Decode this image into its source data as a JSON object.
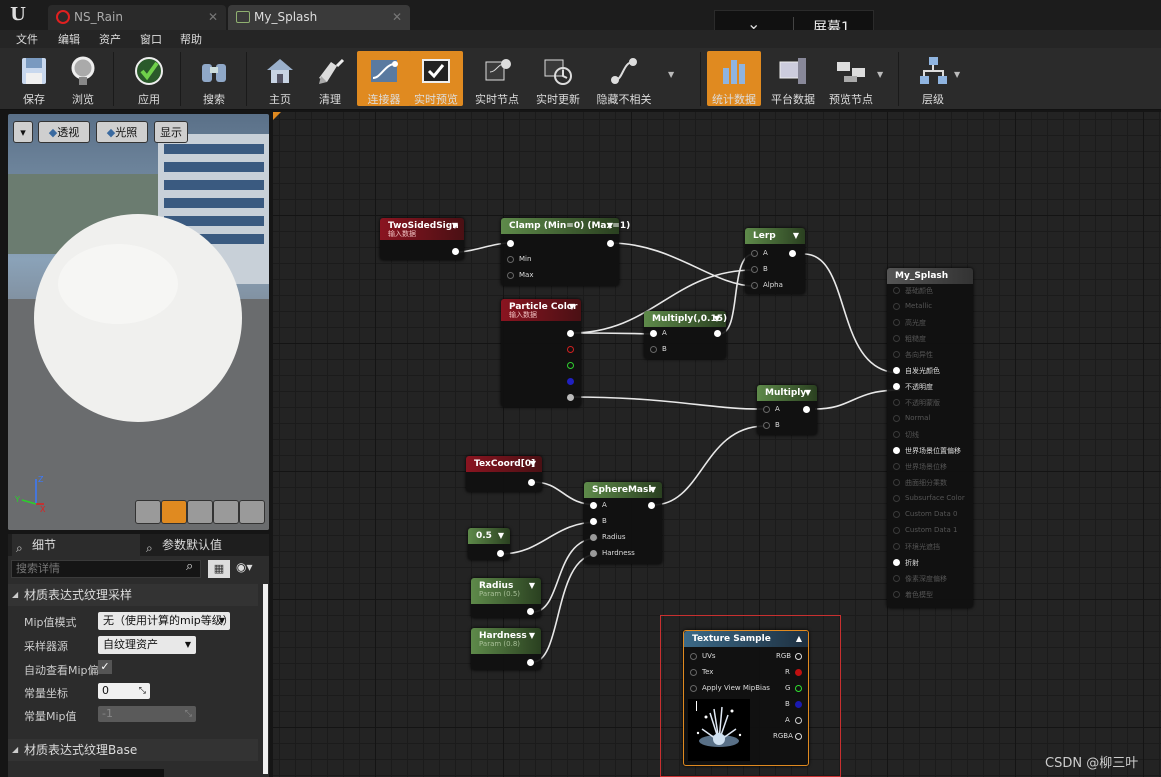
{
  "tabs": [
    {
      "label": "NS_Rain",
      "active": false
    },
    {
      "label": "My_Splash",
      "active": true
    }
  ],
  "screen_label": "屏幕1",
  "menu": [
    "文件",
    "编辑",
    "资产",
    "窗口",
    "帮助"
  ],
  "toolbar": [
    {
      "label": "保存",
      "icon": "save-icon"
    },
    {
      "label": "浏览",
      "icon": "browse-icon"
    },
    {
      "label": "应用",
      "icon": "apply-check-icon"
    },
    {
      "label": "搜索",
      "icon": "search-binoculars-icon"
    },
    {
      "label": "主页",
      "icon": "home-icon"
    },
    {
      "label": "清理",
      "icon": "clean-icon"
    },
    {
      "label": "连接器",
      "icon": "connector-icon",
      "active": true
    },
    {
      "label": "实时预览",
      "icon": "live-preview-icon",
      "active": true
    },
    {
      "label": "实时节点",
      "icon": "live-nodes-icon"
    },
    {
      "label": "实时更新",
      "icon": "live-update-icon"
    },
    {
      "label": "隐藏不相关",
      "icon": "hide-unrelated-icon"
    },
    {
      "label": "统计数据",
      "icon": "stats-icon",
      "active": true
    },
    {
      "label": "平台数据",
      "icon": "platform-stats-icon"
    },
    {
      "label": "预览节点",
      "icon": "preview-node-icon"
    },
    {
      "label": "层级",
      "icon": "hierarchy-icon"
    }
  ],
  "viewport": {
    "perspective": "透视",
    "lighting": "光照",
    "show": "显示",
    "axes": {
      "x": "X",
      "y": "Y",
      "z": "Z"
    }
  },
  "details": {
    "tab_details": "细节",
    "tab_defaults": "参数默认值",
    "search_placeholder": "搜索详情",
    "category1": "材质表达式纹理采样",
    "mip_mode_label": "Mip值模式",
    "mip_mode_value": "无（使用计算的mip等级）",
    "sampler_source_label": "采样器源",
    "sampler_source_value": "自纹理资产",
    "auto_mip_label": "自动查看Mip偏",
    "auto_mip_checked": true,
    "const_coord_label": "常量坐标",
    "const_coord_value": "0",
    "const_mip_label": "常量Mip值",
    "const_mip_value": "-1",
    "category2": "材质表达式纹理Base"
  },
  "nodes": {
    "twosided": {
      "title": "TwoSidedSign",
      "sub": "输入数据"
    },
    "clamp": {
      "title": "Clamp (Min=0) (Max=1)",
      "pins": [
        "Min",
        "Max"
      ]
    },
    "lerp": {
      "title": "Lerp",
      "pins": [
        "A",
        "B",
        "Alpha"
      ]
    },
    "particle": {
      "title": "Particle Color",
      "sub": "输入数据"
    },
    "multiply015": {
      "title": "Multiply(,0.15)",
      "pins": [
        "A",
        "B"
      ]
    },
    "multiply": {
      "title": "Multiply",
      "pins": [
        "A",
        "B"
      ]
    },
    "texcoord": {
      "title": "TexCoord[0]"
    },
    "spheremask": {
      "title": "SphereMask",
      "pins": [
        "A",
        "B",
        "Radius",
        "Hardness"
      ]
    },
    "const05": {
      "title": "0.5"
    },
    "radius": {
      "title": "Radius",
      "sub": "Param (0.5)"
    },
    "hardness": {
      "title": "Hardness",
      "sub": "Param (0.8)"
    },
    "texsample": {
      "title": "Texture Sample",
      "inputs": [
        "UVs",
        "Tex",
        "Apply View MipBias"
      ],
      "outputs": [
        "RGB",
        "R",
        "G",
        "B",
        "A",
        "RGBA"
      ]
    },
    "result": {
      "title": "My_Splash",
      "pins": [
        {
          "label": "基础颜色",
          "active": false
        },
        {
          "label": "Metallic",
          "active": false
        },
        {
          "label": "高光度",
          "active": false
        },
        {
          "label": "粗糙度",
          "active": false
        },
        {
          "label": "各向异性",
          "active": false
        },
        {
          "label": "自发光颜色",
          "active": true
        },
        {
          "label": "不透明度",
          "active": true
        },
        {
          "label": "不透明蒙版",
          "active": false
        },
        {
          "label": "Normal",
          "active": false
        },
        {
          "label": "切线",
          "active": false
        },
        {
          "label": "世界场景位置偏移",
          "active": true
        },
        {
          "label": "世界场景位移",
          "active": false
        },
        {
          "label": "曲面细分乘数",
          "active": false
        },
        {
          "label": "Subsurface Color",
          "active": false
        },
        {
          "label": "Custom Data 0",
          "active": false
        },
        {
          "label": "Custom Data 1",
          "active": false
        },
        {
          "label": "环境光遮挡",
          "active": false
        },
        {
          "label": "折射",
          "active": true
        },
        {
          "label": "像素深度偏移",
          "active": false
        },
        {
          "label": "着色模型",
          "active": false
        }
      ]
    }
  },
  "watermark": "CSDN @柳三叶",
  "colors": {
    "accent": "#e08a20",
    "selection": "#c83030"
  }
}
